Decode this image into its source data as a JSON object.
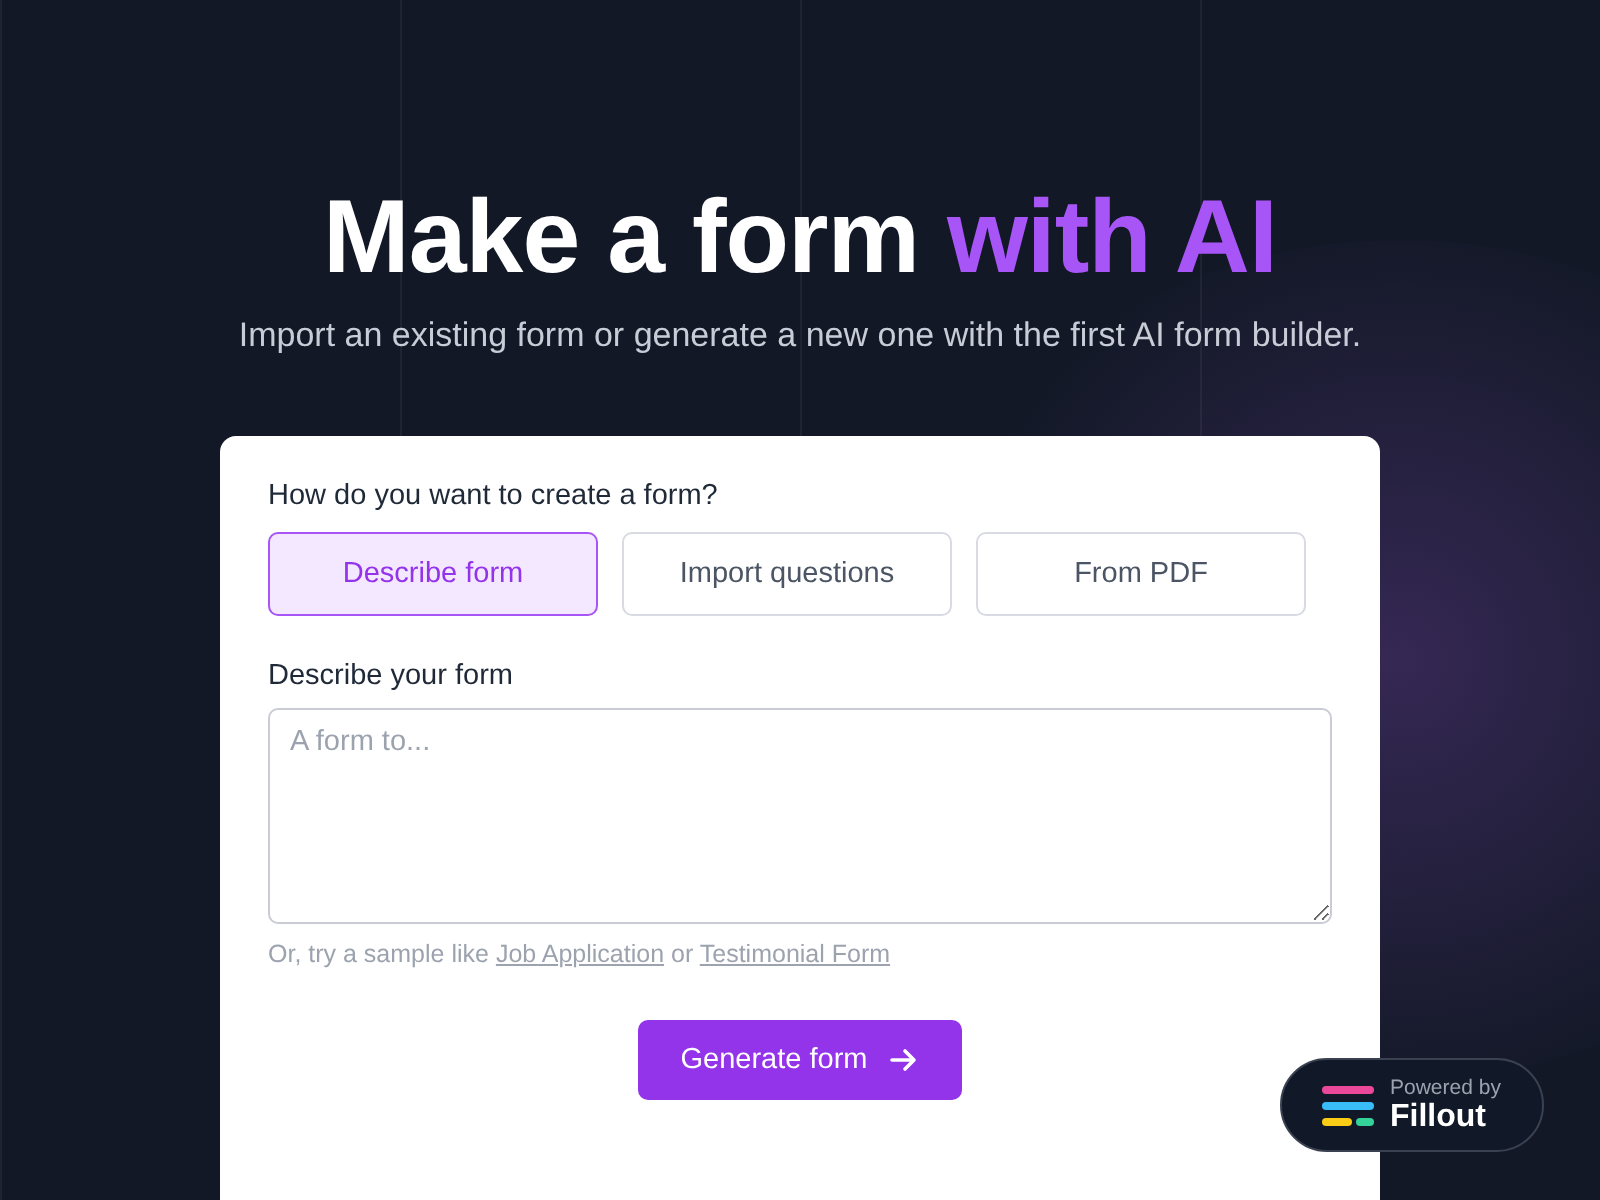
{
  "hero": {
    "title": "Make a form ",
    "title_highlight": "with AI",
    "subtitle": "Import an existing form or generate a new one with the first AI form builder."
  },
  "form_card": {
    "question": "How do you want to create a form?",
    "options": [
      {
        "label": "Describe form",
        "selected": true
      },
      {
        "label": "Import questions",
        "selected": false
      },
      {
        "label": "From PDF",
        "selected": false
      }
    ],
    "field_label": "Describe your form",
    "placeholder": "A form to...",
    "hint": {
      "lead": "Or, try a sample like ",
      "link_1": "Job Application",
      "middle": " or ",
      "link_2": "Testimonial Form"
    },
    "submit": "Generate form"
  },
  "badge": {
    "caption": "Powered by",
    "brand": "Fillout"
  }
}
